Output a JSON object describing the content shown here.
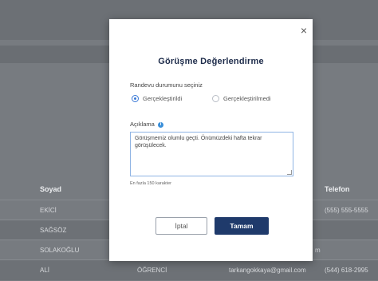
{
  "background": {
    "table_headers": [
      "Soyad",
      "Telefon"
    ],
    "rows": [
      {
        "soyad": "EKİCİ",
        "telefon": "(555) 555-5555",
        "extra": ""
      },
      {
        "soyad": "SAĞSÖZ",
        "telefon": "",
        "extra": ""
      },
      {
        "soyad": "SOLAKOĞLU",
        "telefon": "",
        "extra": "m"
      },
      {
        "soyad": "ALİ",
        "role": "ÖĞRENCİ",
        "email": "tarkangokkaya@gmail.com",
        "telefon": "(544) 618-2995"
      }
    ]
  },
  "modal": {
    "title": "Görüşme Değerlendirme",
    "close_label": "×",
    "status_prompt": "Randevu durumunu seçiniz",
    "options": [
      {
        "label": "Gerçekleştirildi",
        "checked": true
      },
      {
        "label": "Gerçekleştirilmedi",
        "checked": false
      }
    ],
    "description_label": "Açıklama",
    "info_icon": "i",
    "description_value": "Görüşmemiz olumlu geçti. Önümüzdeki hafta tekrar görüşülecek.",
    "hint": "En fazla 150 karakter",
    "cancel_label": "İptal",
    "ok_label": "Tamam"
  },
  "colors": {
    "primary": "#1f3a6b",
    "accent": "#3a79d6",
    "overlay": "#777b80"
  }
}
